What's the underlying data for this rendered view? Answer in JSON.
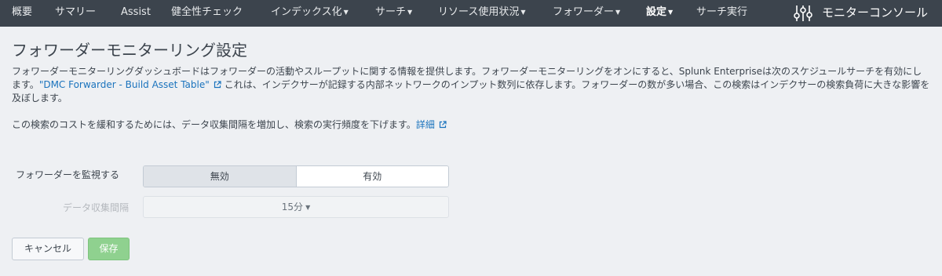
{
  "nav": {
    "items": [
      {
        "label": "概要",
        "caret": ""
      },
      {
        "label": "サマリー",
        "caret": ""
      },
      {
        "label": "Assist",
        "caret": ""
      },
      {
        "label": "健全性チェック",
        "caret": ""
      },
      {
        "label": "インデックス化",
        "caret": "▼"
      },
      {
        "label": "サーチ",
        "caret": "▼"
      },
      {
        "label": "リソース使用状況",
        "caret": "▼"
      },
      {
        "label": "フォワーダー",
        "caret": "▼"
      },
      {
        "label": "設定",
        "caret": "▼"
      },
      {
        "label": "サーチ実行",
        "caret": ""
      }
    ],
    "app_title": "モニターコンソール",
    "app_icon": "sliders-icon"
  },
  "page": {
    "title": "フォワーダーモニターリング設定",
    "desc_part1": "フォワーダーモニターリングダッシュボードはフォワーダーの活動やスループットに関する情報を提供します。フォワーダーモニターリングをオンにすると、Splunk Enterpriseは次のスケジュールサーチを有効にします。",
    "desc_link": "\"DMC Forwarder - Build Asset Table\"",
    "desc_part2": "これは、インデクサーが記録する内部ネットワークのインプット数列に依存します。フォワーダーの数が多い場合、この検索はインデクサーの検索負荷に大きな影響を及ぼします。",
    "desc2_text": "この検索のコストを緩和するためには、データ収集間隔を増加し、検索の実行頻度を下げます。",
    "desc2_link": "詳細"
  },
  "form": {
    "monitor_label": "フォワーダーを監視する",
    "toggle_off": "無効",
    "toggle_on": "有効",
    "interval_label": "データ収集間隔",
    "interval_value": "15分",
    "interval_caret": "▼"
  },
  "buttons": {
    "cancel": "キャンセル",
    "save": "保存"
  },
  "colors": {
    "nav_bg": "#3c444d",
    "link": "#1a73bd",
    "save_bg": "#8fd18f"
  }
}
